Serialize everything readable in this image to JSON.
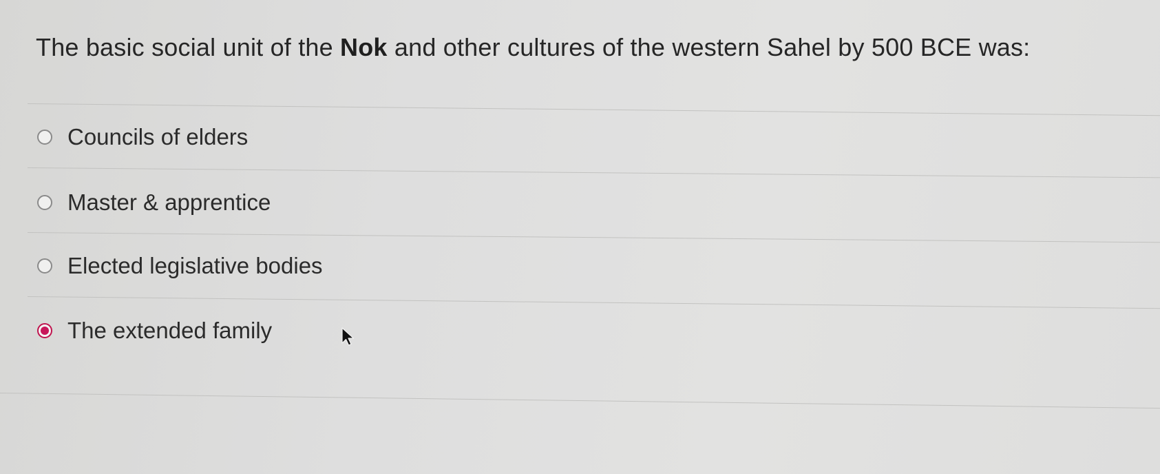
{
  "question": {
    "prefix": "The basic social unit of the ",
    "bold": "Nok",
    "suffix": " and other cultures of the western Sahel by 500 BCE was:"
  },
  "options": [
    {
      "label": "Councils of elders",
      "selected": false
    },
    {
      "label": "Master & apprentice",
      "selected": false
    },
    {
      "label": "Elected legislative bodies",
      "selected": false
    },
    {
      "label": "The extended family",
      "selected": true
    }
  ],
  "colors": {
    "selected_accent": "#c8175a"
  },
  "icons": {
    "radio": "radio-button-icon",
    "pointer": "mouse-pointer-icon"
  }
}
